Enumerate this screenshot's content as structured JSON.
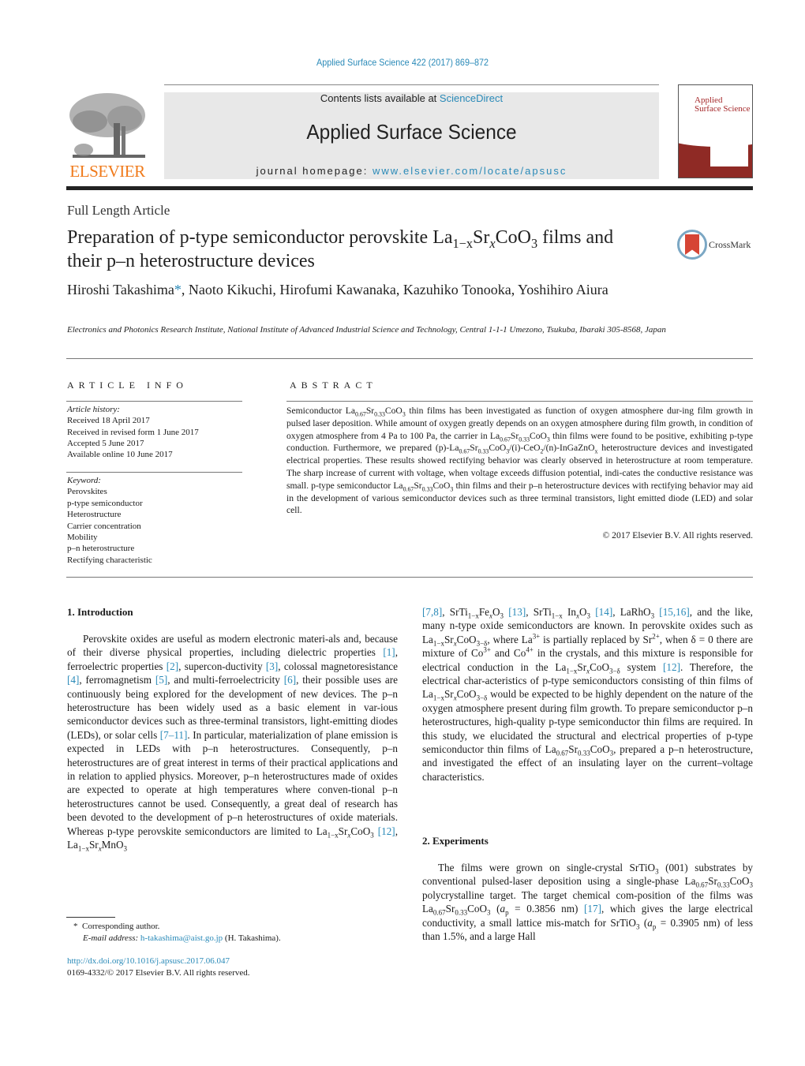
{
  "header": {
    "citation": "Applied Surface Science 422 (2017) 869–872",
    "contents_prefix": "Contents lists available at ",
    "contents_link": "ScienceDirect",
    "journal_title": "Applied Surface Science",
    "homepage_prefix": "journal homepage: ",
    "homepage_link": "www.elsevier.com/locate/apsusc",
    "publisher_logo_text": "ELSEVIER",
    "cover_title_1": "Applied",
    "cover_title_2": "Surface Science",
    "colors": {
      "link": "#2a8ab8",
      "elsevier_orange": "#f07a1a",
      "cover_red": "#8f2a25",
      "crossmark_red": "#d64535"
    }
  },
  "article": {
    "type": "Full Length Article",
    "title_part1": "Preparation of p-type semiconductor perovskite La",
    "title_sub1": "1−x",
    "title_part2": "Sr",
    "title_sub2": "x",
    "title_part3": "CoO",
    "title_sub3": "3",
    "title_part4": " films and their p–n heterostructure devices",
    "crossmark_label": "CrossMark",
    "authors_1": "Hiroshi Takashima",
    "authors_star": "*",
    "authors_2": ", Naoto Kikuchi, Hirofumi Kawanaka, Kazuhiko Tonooka, Yoshihiro Aiura",
    "affiliation": "Electronics and Photonics Research Institute, National Institute of Advanced Industrial Science and Technology, Central 1-1-1 Umezono, Tsukuba, Ibaraki 305-8568, Japan"
  },
  "article_info": {
    "heading": "ARTICLE INFO",
    "history_label": "Article history:",
    "history": [
      "Received 18 April 2017",
      "Received in revised form 1 June 2017",
      "Accepted 5 June 2017",
      "Available online 10 June 2017"
    ],
    "keyword_label": "Keyword:",
    "keywords": [
      "Perovskites",
      "p-type semiconductor",
      "Heterostructure",
      "Carrier concentration",
      "Mobility",
      "p–n heterostructure",
      "Rectifying characteristic"
    ]
  },
  "abstract": {
    "heading": "ABSTRACT",
    "copyright": "© 2017 Elsevier B.V. All rights reserved."
  },
  "sections": {
    "intro_heading": "1.  Introduction",
    "exp_heading": "2.  Experiments"
  },
  "refs": {
    "r1": "[1]",
    "r2": "[2]",
    "r3": "[3]",
    "r4": "[4]",
    "r5": "[5]",
    "r6": "[6]",
    "r7_11": "[7–11]",
    "r12": "[12]",
    "r7_8": "[7,8]",
    "r13": "[13]",
    "r14": "[14]",
    "r15_16": "[15,16]",
    "r17": "[17]"
  },
  "footnote": {
    "star": "*",
    "corresponding": "Corresponding author.",
    "email_label": "E-mail address: ",
    "email": "h-takashima@aist.go.jp",
    "email_suffix": " (H. Takashima).",
    "doi": "http://dx.doi.org/10.1016/j.apsusc.2017.06.047",
    "issn": "0169-4332/© 2017 Elsevier B.V. All rights reserved."
  }
}
